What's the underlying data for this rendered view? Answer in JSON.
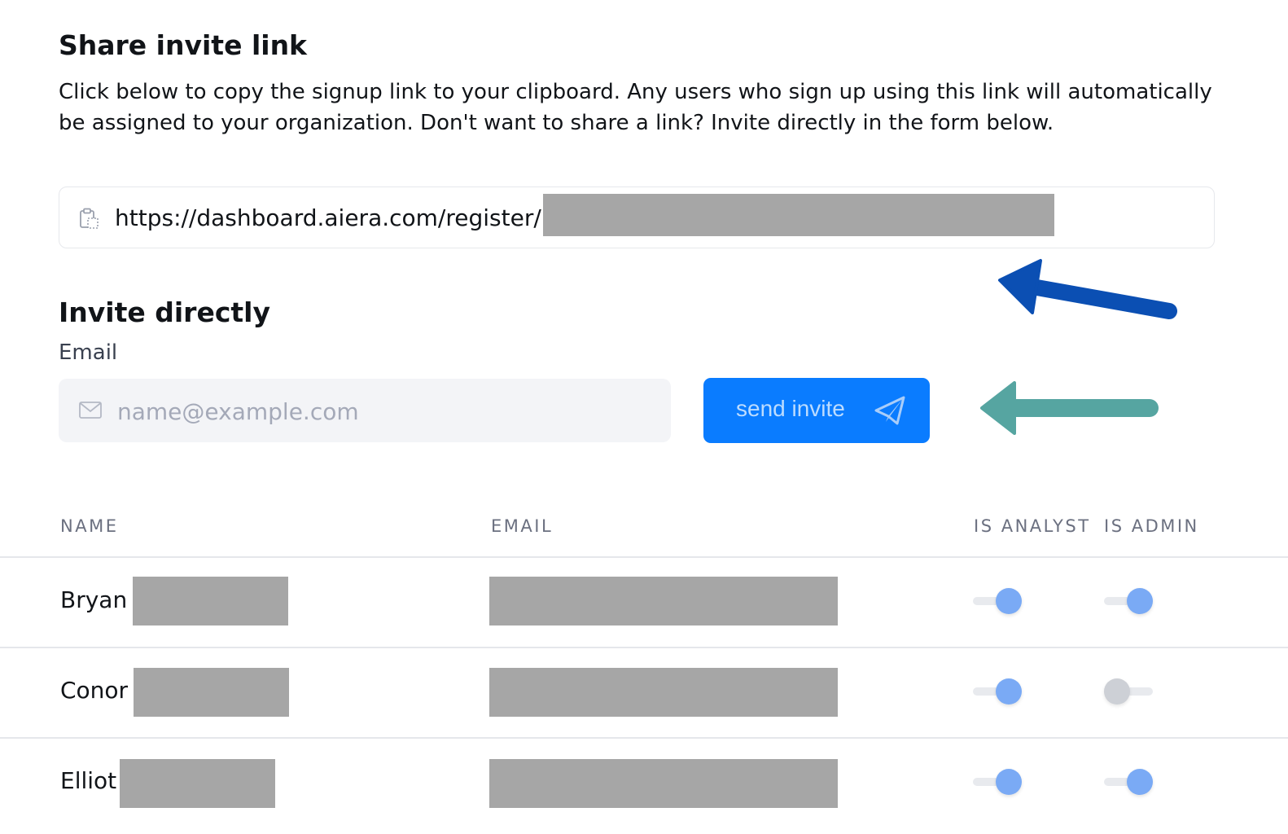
{
  "share": {
    "title": "Share invite link",
    "description": "Click below to copy the signup link to your clipboard. Any users who sign up using this link will automatically be assigned to your organization. Don't want to share a link? Invite directly in the form below.",
    "link_prefix": "https://dashboard.aiera.com/register/",
    "icon": "clipboard-icon"
  },
  "invite": {
    "title": "Invite directly",
    "email_label": "Email",
    "email_value": "",
    "email_placeholder": "name@example.com",
    "email_icon": "mail-icon",
    "send_label": "send invite",
    "send_icon": "paper-plane-icon"
  },
  "table": {
    "headers": {
      "name": "NAME",
      "email": "EMAIL",
      "is_analyst": "IS ANALYST",
      "is_admin": "IS ADMIN"
    },
    "rows": [
      {
        "first_name": "Bryan",
        "is_analyst": true,
        "is_admin": true
      },
      {
        "first_name": "Conor",
        "is_analyst": true,
        "is_admin": false
      },
      {
        "first_name": "Elliot",
        "is_analyst": true,
        "is_admin": true
      }
    ]
  },
  "colors": {
    "accent": "#0a7cff",
    "toggle_on": "#7aaaf5",
    "toggle_off": "#cdd0d6",
    "annotation_arrow_1": "#0b4fb3",
    "annotation_arrow_2": "#56a5a1",
    "redaction": "#a6a6a6"
  }
}
